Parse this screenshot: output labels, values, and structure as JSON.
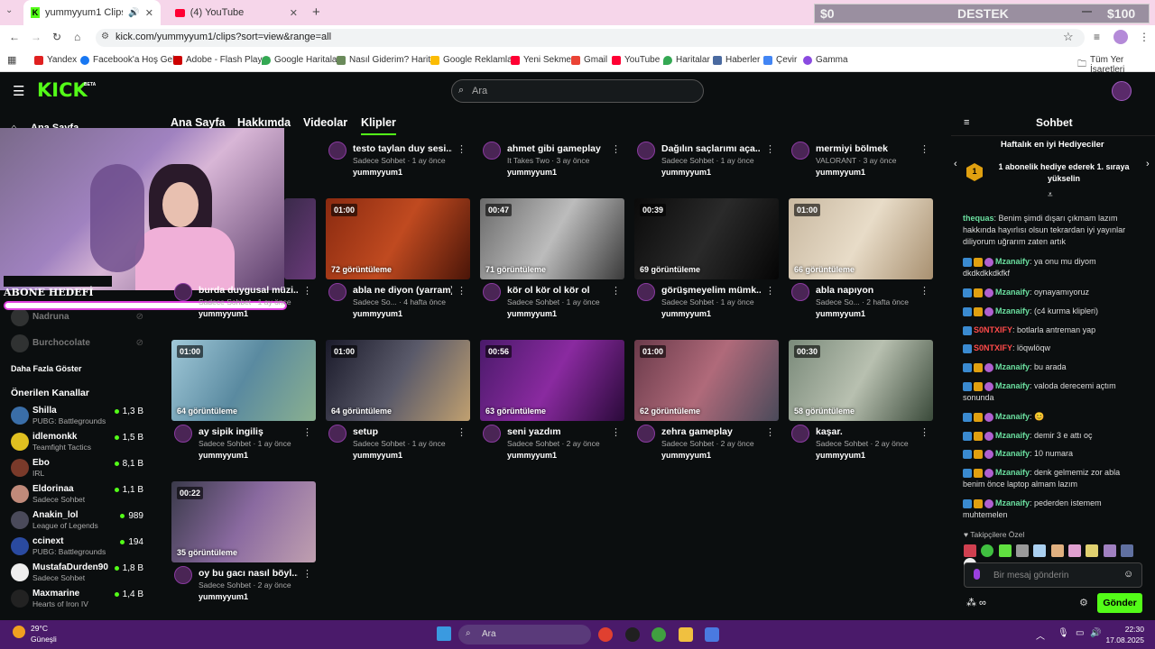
{
  "browser": {
    "tabs": [
      {
        "label": "yummyyum1 Clips - Watch"
      },
      {
        "label": "(4) YouTube"
      }
    ],
    "url": "kick.com/yummyyum1/clips?sort=view&range=all",
    "bookmarks": [
      "Yandex",
      "Facebook'a Hoş Gel...",
      "Adobe - Flash Player",
      "Google Haritalar",
      "Nasıl Giderim? Harit...",
      "Google Reklamları",
      "Yeni Sekme",
      "Gmail",
      "YouTube",
      "Haritalar",
      "Haberler",
      "Çevir",
      "Gamma"
    ],
    "all_bookmarks": "Tüm Yer İşaretleri"
  },
  "donate": {
    "left": "$0",
    "center": "DESTEK",
    "right": "$100"
  },
  "header": {
    "logo": "KICK",
    "beta": "BETA",
    "search_placeholder": "Ara"
  },
  "stream_overlay": {
    "goal_label": "ABONE HEDEFİ",
    "goal_progress": 0.82
  },
  "sidebar": {
    "home": "Ana Sayfa",
    "followed": [
      {
        "name": "Nadruna"
      },
      {
        "name": "Burchocolate"
      }
    ],
    "show_more": "Daha Fazla Göster",
    "recommended_title": "Önerilen Kanallar",
    "recommended": [
      {
        "name": "Shilla",
        "category": "PUBG: Battlegrounds",
        "viewers": "1,3 B",
        "color": "#3a6ea8"
      },
      {
        "name": "idlemonkk",
        "category": "Teamfight Tactics",
        "viewers": "1,5 B",
        "color": "#e0c020"
      },
      {
        "name": "Ebo",
        "category": "IRL",
        "viewers": "8,1 B",
        "color": "#7a3a2a"
      },
      {
        "name": "Eldorinaa",
        "category": "Sadece Sohbet",
        "viewers": "1,1 B",
        "color": "#c08a7a"
      },
      {
        "name": "Anakin_lol",
        "category": "League of Legends",
        "viewers": "989",
        "color": "#4a4a5a"
      },
      {
        "name": "ccinext",
        "category": "PUBG: Battlegrounds",
        "viewers": "194",
        "color": "#2a4aa0"
      },
      {
        "name": "MustafaDurden90",
        "category": "Sadece Sohbet",
        "viewers": "1,8 B",
        "color": "#eeeeee"
      },
      {
        "name": "Maxmarine",
        "category": "Hearts of Iron IV",
        "viewers": "1,4 B",
        "color": "#222222"
      }
    ]
  },
  "nav": {
    "tabs": [
      "Ana Sayfa",
      "Hakkımda",
      "Videolar",
      "Klipler"
    ]
  },
  "clips_top": [
    {
      "title": "testo taylan duy sesi...",
      "meta": "Sadece Sohbet · 1 ay önce",
      "user": "yummyyum1"
    },
    {
      "title": "ahmet gibi gameplay",
      "meta": "It Takes Two · 3 ay önce",
      "user": "yummyyum1"
    },
    {
      "title": "Dağılın saçlarımı aça...",
      "meta": "Sadece Sohbet · 1 ay önce",
      "user": "yummyyum1"
    },
    {
      "title": "mermiyi bölmek",
      "meta": "VALORANT · 3 ay önce",
      "user": "yummyyum1"
    }
  ],
  "clips": [
    {
      "dur": "",
      "views": "",
      "title": "burda duygusal müzi...",
      "meta": "Sadece Sohbet · 1 ay önce",
      "user": "yummyyum1",
      "bg": "linear-gradient(120deg,#3a2a4a,#6a3a7a)"
    },
    {
      "dur": "01:00",
      "views": "72 görüntüleme",
      "title": "abla ne diyon (yarram)",
      "meta": "Sadece So... · 4 hafta önce",
      "user": "yummyyum1",
      "bg": "linear-gradient(120deg,#8a2a10,#c04a20,#4a1508)"
    },
    {
      "dur": "00:47",
      "views": "71 görüntüleme",
      "title": "kör ol kör ol kör ol",
      "meta": "Sadece Sohbet · 1 ay önce",
      "user": "yummyyum1",
      "bg": "linear-gradient(120deg,#6a6a6a,#bcbcbc,#3a3a3a)"
    },
    {
      "dur": "00:39",
      "views": "69 görüntüleme",
      "title": "görüşmeyelim mümk...",
      "meta": "Sadece Sohbet · 1 ay önce",
      "user": "yummyyum1",
      "bg": "linear-gradient(120deg,#0a0a0a,#2a2a2a,#050505)"
    },
    {
      "dur": "01:00",
      "views": "66 görüntüleme",
      "title": "abla napıyon",
      "meta": "Sadece So... · 2 hafta önce",
      "user": "yummyyum1",
      "bg": "linear-gradient(120deg,#c8b8a0,#e8dcc8,#a89070)"
    },
    {
      "dur": "01:00",
      "views": "64 görüntüleme",
      "title": "ay sipik ingiliş",
      "meta": "Sadece Sohbet · 1 ay önce",
      "user": "yummyyum1",
      "bg": "linear-gradient(120deg,#a0c8d8,#5a8aa0,#8ab090)"
    },
    {
      "dur": "01:00",
      "views": "64 görüntüleme",
      "title": "setup",
      "meta": "Sadece Sohbet · 1 ay önce",
      "user": "yummyyum1",
      "bg": "linear-gradient(120deg,#1a1a2a,#5a5a6a,#c0a070)"
    },
    {
      "dur": "00:56",
      "views": "63 görüntüleme",
      "title": "seni yazdım",
      "meta": "Sadece Sohbet · 2 ay önce",
      "user": "yummyyum1",
      "bg": "linear-gradient(120deg,#4a1a6a,#8a2aa0,#2a0a3a)"
    },
    {
      "dur": "01:00",
      "views": "62 görüntüleme",
      "title": "zehra gameplay",
      "meta": "Sadece Sohbet · 2 ay önce",
      "user": "yummyyum1",
      "bg": "linear-gradient(120deg,#6a3a4a,#b06a7a,#4a4a5a)"
    },
    {
      "dur": "00:30",
      "views": "58 görüntüleme",
      "title": "kaşar.",
      "meta": "Sadece Sohbet · 2 ay önce",
      "user": "yummyyum1",
      "bg": "linear-gradient(120deg,#7a8a7a,#b8c0b0,#3a4a3a)"
    },
    {
      "dur": "00:22",
      "views": "35 görüntüleme",
      "title": "oy bu gacı nasıl böyl...",
      "meta": "Sadece Sohbet · 2 ay önce",
      "user": "yummyyum1",
      "bg": "linear-gradient(120deg,#3a3a4a,#8a6aa0,#c0a0b0)"
    }
  ],
  "chat": {
    "title": "Sohbet",
    "top_gifters": "Haftalık en iyi Hediyeciler",
    "gift_prompt": "1 abonelik hediye ederek 1. sıraya yükselin",
    "messages": [
      {
        "user": "thequas",
        "text": "Benim şimdi dışarı çıkmam lazım hakkında hayırlısı olsun tekrardan iyi yayınlar diliyorum uğrarım zaten artık",
        "red": false
      },
      {
        "user": "Mzanaify",
        "text": "ya onu mu diyom dkdkdkkdkfkf",
        "red": false
      },
      {
        "user": "Mzanaify",
        "text": "oynayamıyoruz",
        "red": false
      },
      {
        "user": "Mzanaify",
        "text": "(c4 kurma klipleri)",
        "red": false
      },
      {
        "user": "S0NTXIFY",
        "text": "botlarla antreman yap",
        "red": true
      },
      {
        "user": "S0NTXIFY",
        "text": "löqwlöqw",
        "red": true
      },
      {
        "user": "Mzanaify",
        "text": "bu arada",
        "red": false
      },
      {
        "user": "Mzanaify",
        "text": "valoda derecemi açtım sonunda",
        "red": false
      },
      {
        "user": "Mzanaify",
        "text": "😊",
        "red": false
      },
      {
        "user": "Mzanaify",
        "text": "demir 3 e attı oç",
        "red": false
      },
      {
        "user": "Mzanaify",
        "text": "10 numara",
        "red": false
      },
      {
        "user": "Mzanaify",
        "text": "denk gelmemiz zor abla benim önce laptop almam lazım",
        "red": false
      },
      {
        "user": "Mzanaify",
        "text": "pederden istemem muhtemelen",
        "red": false
      }
    ],
    "followers_only": "Takipçilere Özel",
    "input_placeholder": "Bir mesaj gönderin",
    "send": "Gönder"
  },
  "taskbar": {
    "weather_temp": "29°C",
    "weather_desc": "Güneşli",
    "search": "Ara",
    "time": "22:30",
    "date": "17.08.2025"
  }
}
